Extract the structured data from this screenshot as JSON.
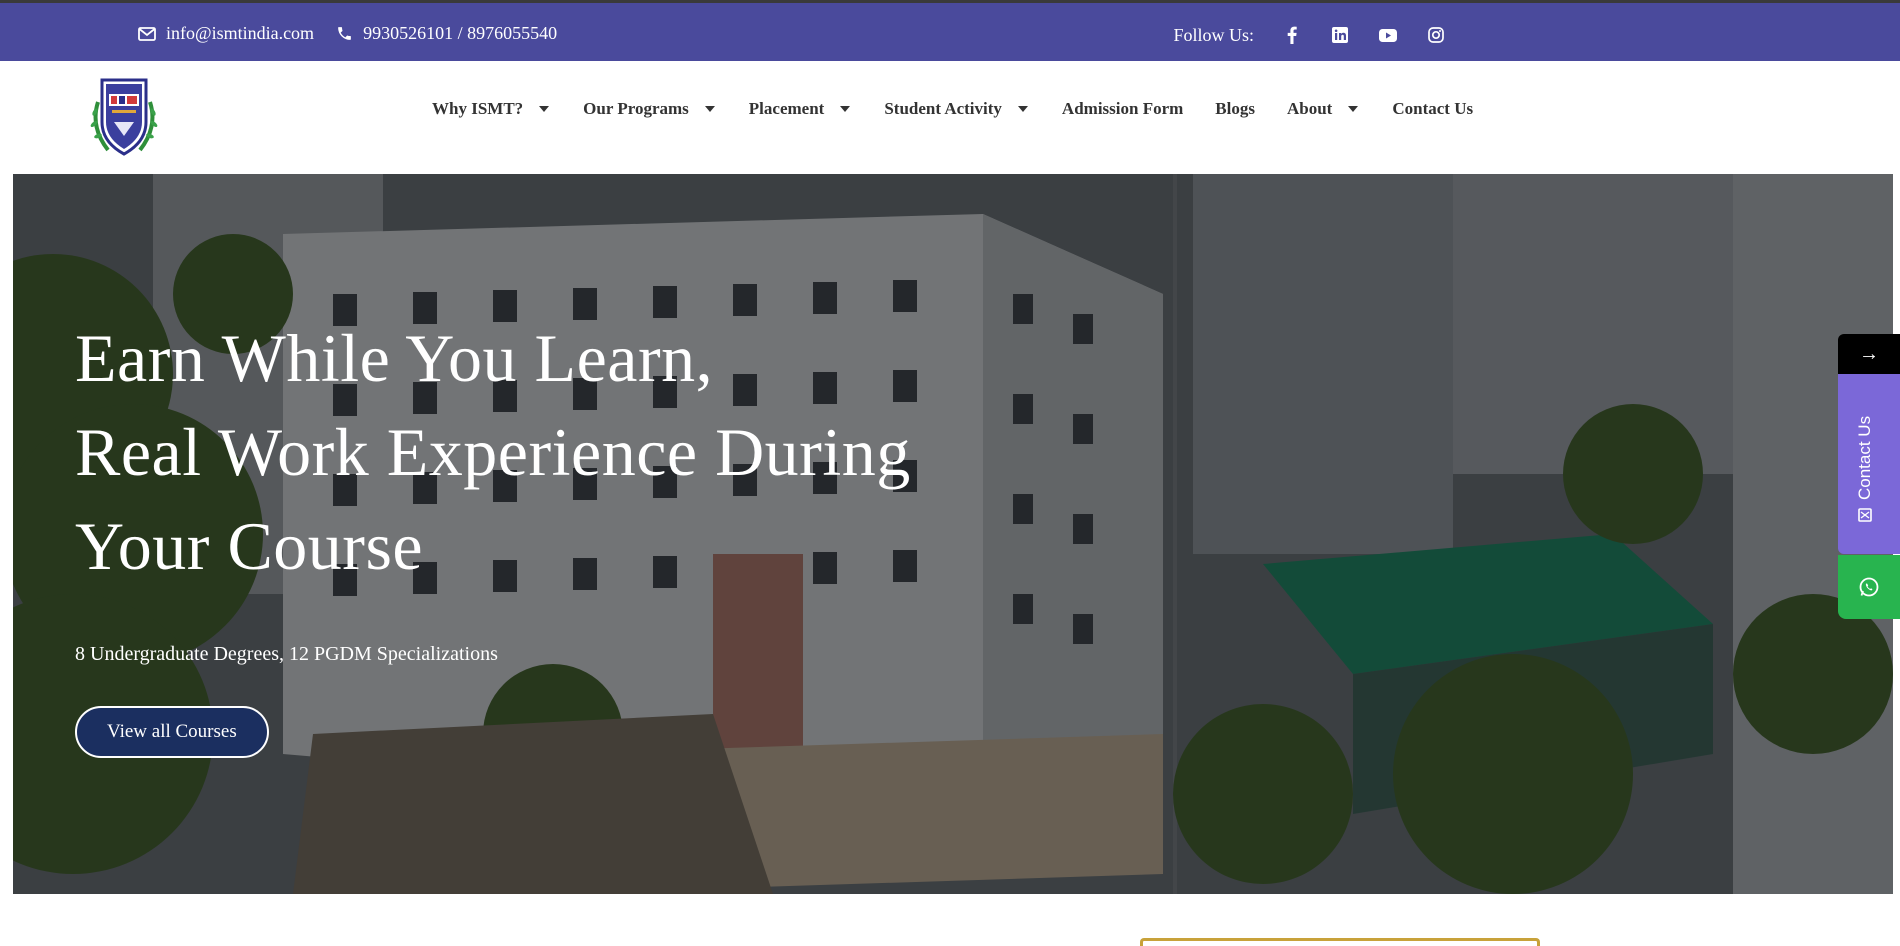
{
  "topbar": {
    "email": "info@ismtindia.com",
    "phone": "9930526101 / 8976055540",
    "follow_label": "Follow Us:",
    "socials": [
      "facebook-icon",
      "linkedin-icon",
      "youtube-icon",
      "instagram-icon"
    ]
  },
  "nav": {
    "items": [
      {
        "label": "Why ISMT?",
        "dropdown": true
      },
      {
        "label": "Our Programs",
        "dropdown": true
      },
      {
        "label": "Placement",
        "dropdown": true
      },
      {
        "label": "Student Activity",
        "dropdown": true
      },
      {
        "label": "Admission Form",
        "dropdown": false
      },
      {
        "label": "Blogs",
        "dropdown": false
      },
      {
        "label": "About",
        "dropdown": true
      },
      {
        "label": "Contact Us",
        "dropdown": false
      }
    ]
  },
  "hero": {
    "line1": "Earn While You Learn,",
    "line2": "Real Work Experience During",
    "line3": "Your Course",
    "subtitle": "8 Undergraduate Degrees, 12 PGDM Specializations",
    "cta": "View all Courses"
  },
  "side": {
    "arrow": "→",
    "contact_label": "Contact Us"
  },
  "colors": {
    "topbar": "#4a4a9c",
    "cta_bg": "#1b2f60",
    "side_contact": "#7b68d8",
    "whatsapp": "#28b44f",
    "frame_gold": "#c8a23a"
  }
}
